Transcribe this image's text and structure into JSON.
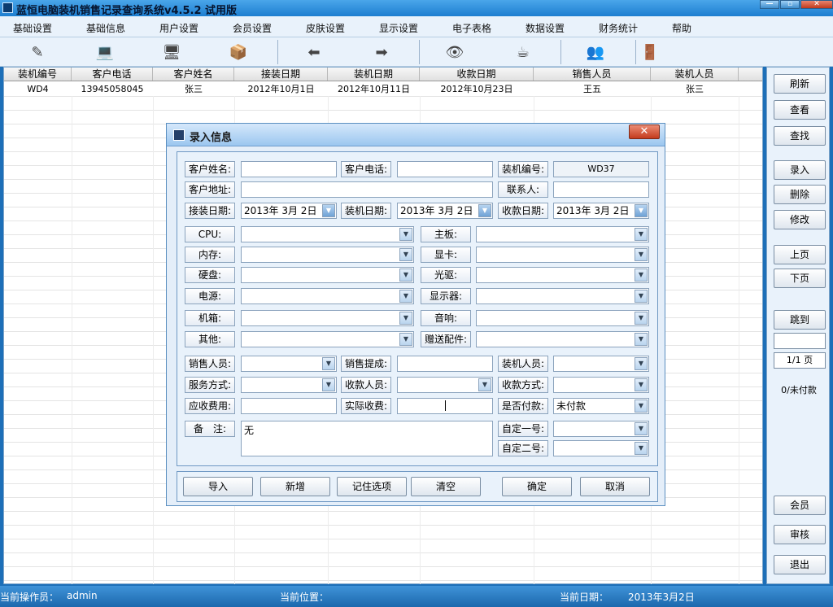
{
  "window": {
    "title": "蓝恒电脑装机销售记录查询系统v4.5.2 试用版"
  },
  "menu": [
    "基础设置",
    "基础信息",
    "用户设置",
    "会员设置",
    "皮肤设置",
    "显示设置",
    "电子表格",
    "数据设置",
    "财务统计",
    "帮助"
  ],
  "toolbar_icons": [
    "edit-icon",
    "computer-icon",
    "monitor-icon",
    "package-icon",
    "arrow-left-icon",
    "arrow-right-icon",
    "search-eye-icon",
    "coffee-icon",
    "users-icon",
    "exit-door-icon"
  ],
  "grid": {
    "headers": [
      "装机编号",
      "客户电话",
      "客户姓名",
      "接装日期",
      "装机日期",
      "收款日期",
      "销售人员",
      "装机人员"
    ],
    "rows": [
      [
        "WD4",
        "13945058045",
        "张三",
        "2012年10月1日",
        "2012年10月11日",
        "2012年10月23日",
        "王五",
        "张三"
      ]
    ]
  },
  "side_buttons": {
    "refresh": "刷新",
    "view": "查看",
    "find": "查找",
    "entry": "录入",
    "delete": "删除",
    "edit": "修改",
    "prev": "上页",
    "next": "下页",
    "goto": "跳到",
    "member": "会员",
    "audit": "审核",
    "exit": "退出"
  },
  "pager": {
    "page_info": "1/1 页",
    "unpaid": "0/未付款"
  },
  "statusbar": {
    "operator_label": "当前操作员：",
    "operator": "admin",
    "location_label": "当前位置：",
    "date_label": "当前日期：",
    "date": "2013年3月2日"
  },
  "dialog": {
    "title": "录入信息",
    "labels": {
      "customer_name": "客户姓名:",
      "customer_phone": "客户电话:",
      "install_no": "装机编号:",
      "customer_address": "客户地址:",
      "contact": "联系人:",
      "receive_date": "接装日期:",
      "install_date": "装机日期:",
      "payment_date": "收款日期:",
      "cpu": "CPU:",
      "motherboard": "主板:",
      "memory": "内存:",
      "gpu": "显卡:",
      "hdd": "硬盘:",
      "optical": "光驱:",
      "psu": "电源:",
      "display": "显示器:",
      "case": "机箱:",
      "audio": "音响:",
      "other": "其他:",
      "gift": "赠送配件:",
      "salesperson": "销售人员:",
      "commission": "销售提成:",
      "installer": "装机人员:",
      "service": "服务方式:",
      "collector": "收款人员:",
      "payment_method": "收款方式:",
      "receivable": "应收费用:",
      "actual_paid": "实际收费:",
      "is_paid": "是否付款:",
      "remarks": "备　注:",
      "custom1": "自定一号:",
      "custom2": "自定二号:"
    },
    "values": {
      "install_no": "WD37",
      "receive_date": "2013年 3月 2日",
      "install_date": "2013年 3月 2日",
      "payment_date": "2013年 3月 2日",
      "is_paid": "未付款",
      "remarks": "无"
    },
    "buttons": {
      "import": "导入",
      "add": "新增",
      "remember": "记住选项",
      "clear": "清空",
      "ok": "确定",
      "cancel": "取消"
    },
    "close_glyph": "✕"
  }
}
